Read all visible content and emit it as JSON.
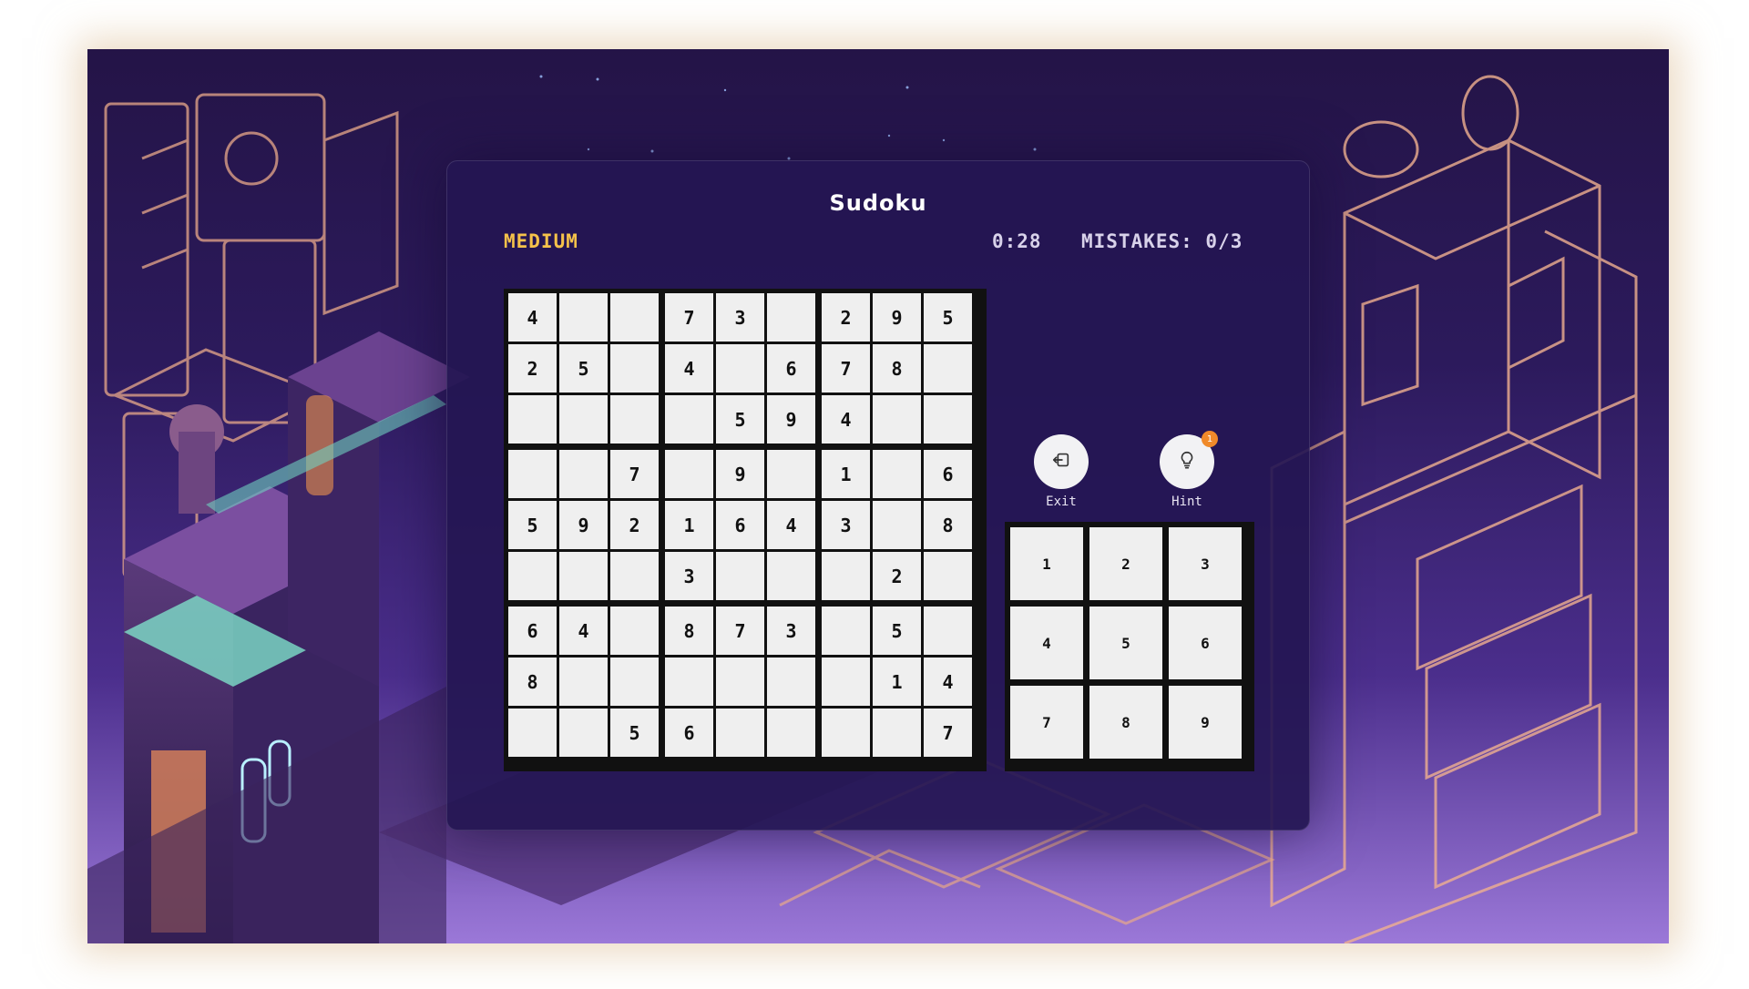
{
  "game": {
    "title": "Sudoku",
    "difficulty": "MEDIUM",
    "timer": "0:28",
    "mistakes": "MISTAKES: 0/3"
  },
  "board": [
    [
      "4",
      "",
      "",
      "7",
      "3",
      "",
      "2",
      "9",
      "5"
    ],
    [
      "2",
      "5",
      "",
      "4",
      "",
      "6",
      "7",
      "8",
      ""
    ],
    [
      "",
      "",
      "",
      "",
      "5",
      "9",
      "4",
      "",
      ""
    ],
    [
      "",
      "",
      "7",
      "",
      "9",
      "",
      "1",
      "",
      "6"
    ],
    [
      "5",
      "9",
      "2",
      "1",
      "6",
      "4",
      "3",
      "",
      "8"
    ],
    [
      "",
      "",
      "",
      "3",
      "",
      "",
      "",
      "2",
      ""
    ],
    [
      "6",
      "4",
      "",
      "8",
      "7",
      "3",
      "",
      "5",
      ""
    ],
    [
      "8",
      "",
      "",
      "",
      "",
      "",
      "",
      "1",
      "4"
    ],
    [
      "",
      "",
      "5",
      "6",
      "",
      "",
      "",
      "",
      "7"
    ]
  ],
  "controls": {
    "exit_label": "Exit",
    "exit_icon": "exit-icon",
    "hint_label": "Hint",
    "hint_icon": "lightbulb-icon",
    "hint_count": "1"
  },
  "numpad": [
    "1",
    "2",
    "3",
    "4",
    "5",
    "6",
    "7",
    "8",
    "9"
  ],
  "colors": {
    "accent": "#f5c24a",
    "panel": "#24164f",
    "badge": "#f08a2a"
  }
}
